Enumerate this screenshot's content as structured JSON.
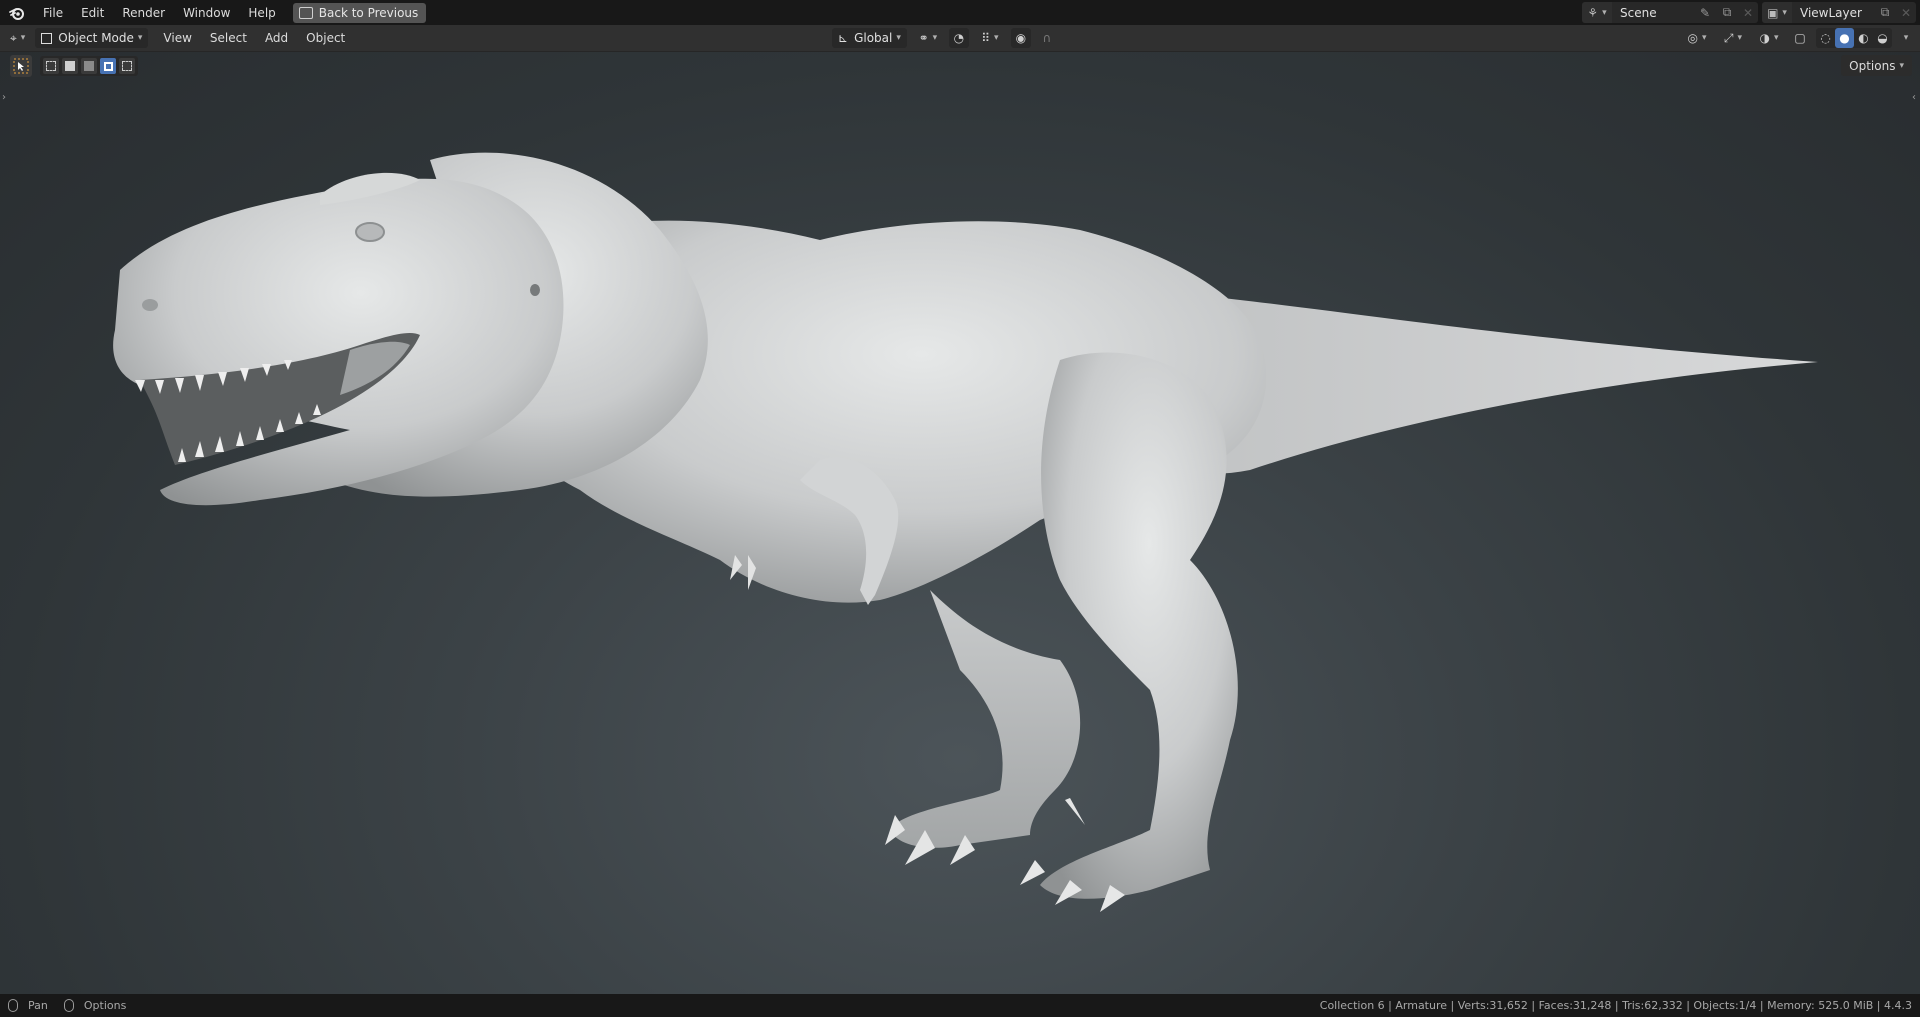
{
  "topbar": {
    "menus": [
      "File",
      "Edit",
      "Render",
      "Window",
      "Help"
    ],
    "back_label": "Back to Previous",
    "scene_name": "Scene",
    "view_layer_name": "ViewLayer"
  },
  "header": {
    "mode": "Object Mode",
    "menus": [
      "View",
      "Select",
      "Add",
      "Object"
    ],
    "transform_orientation": "Global",
    "options_label": "Options"
  },
  "viewport": {
    "object": "Tyrannosaurus sculpt (solid shading)",
    "shading": "solid",
    "background_top": "#292d30",
    "background_center": "#4c5459"
  },
  "status": {
    "left_action": "Pan",
    "left_options": "Options",
    "stats": "Collection 6 | Armature | Verts:31,652 | Faces:31,248 | Tris:62,332 | Objects:1/4 | Memory: 525.0 MiB | 4.4.3"
  },
  "colors": {
    "accent": "#4772b3",
    "topbar_bg": "#181818",
    "header_bg": "#303030"
  }
}
